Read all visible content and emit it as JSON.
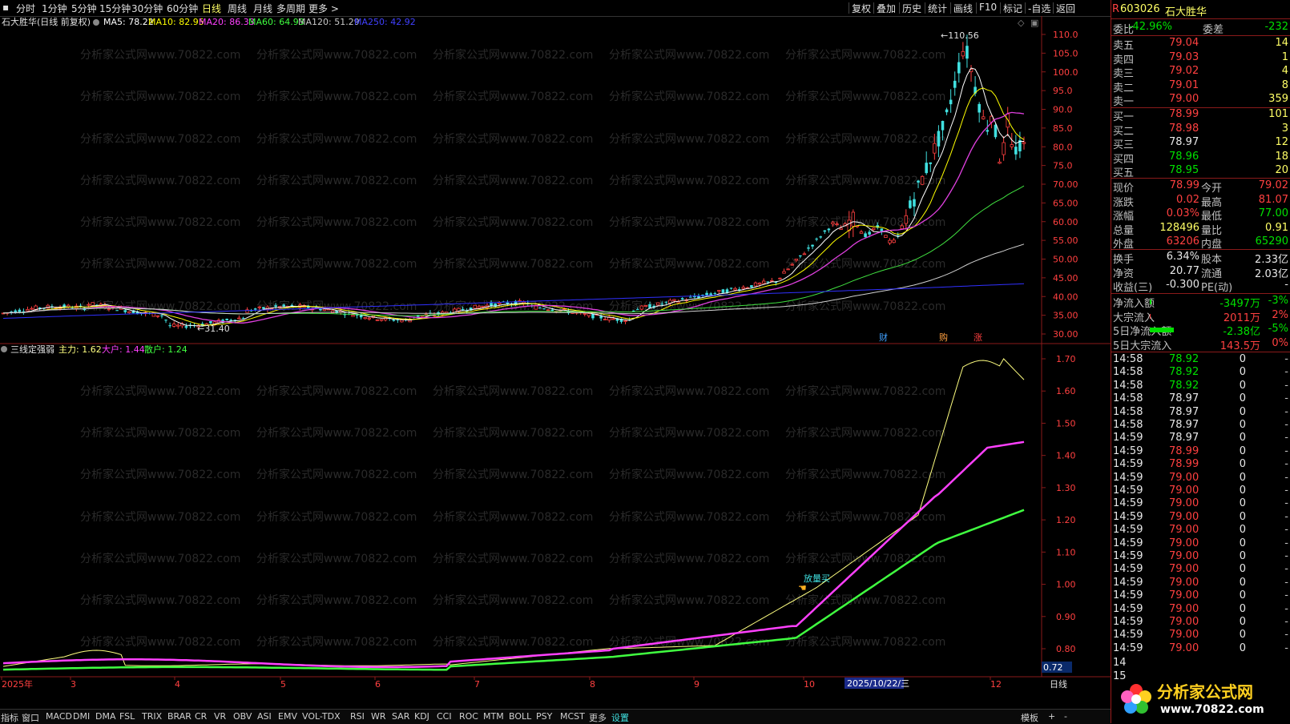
{
  "toolbar": {
    "periods": [
      "分时",
      "1分钟",
      "5分钟",
      "15分钟",
      "30分钟",
      "60分钟",
      "日线",
      "周线",
      "月线",
      "多周期",
      "更多 >"
    ],
    "active_period": "日线",
    "right_tools": [
      "复权",
      "叠加",
      "历史",
      "统计",
      "画线",
      "F10",
      "标记",
      "-自选",
      "返回"
    ]
  },
  "main_chart": {
    "title": "石大胜华(日线 前复权)",
    "ma_labels": [
      {
        "text": "MA5: 78.22",
        "color": "#ffffff"
      },
      {
        "text": "MA10: 82.95",
        "color": "#ffff00"
      },
      {
        "text": "MA20: 86.33",
        "color": "#ff40ff"
      },
      {
        "text": "MA60: 64.93",
        "color": "#40ff40"
      },
      {
        "text": "MA120: 51.29",
        "color": "#c8c8c8"
      },
      {
        "text": "MA250: 42.92",
        "color": "#4040ff"
      }
    ],
    "high_label": "110.56",
    "low_label": "31.40",
    "y_axis": [
      "110.0",
      "105.0",
      "100.0",
      "95.0",
      "90.0",
      "85.0",
      "80.0",
      "75.0",
      "70.00",
      "65.00",
      "60.00",
      "55.00",
      "50.00",
      "45.00",
      "40.00",
      "35.00",
      "30.00"
    ],
    "markers": [
      "财",
      "购",
      "涨"
    ],
    "colors": {
      "up": "#ff4040",
      "down": "#40e0e0",
      "ma5": "#ffffff",
      "ma10": "#ffff00",
      "ma20": "#e040e0",
      "ma60": "#40e040",
      "ma120": "#d0d0d0",
      "ma250": "#3030ff"
    }
  },
  "indicator": {
    "title": "三线定强弱",
    "main_label": "主力: 1.62",
    "large_label": "大户: 1.44",
    "retail_label": "散户: 1.24",
    "y_axis": [
      "1.70",
      "1.60",
      "1.50",
      "1.40",
      "1.30",
      "1.20",
      "1.10",
      "1.00",
      "0.90",
      "0.80"
    ],
    "current_value": "0.72",
    "signal_label": "放量买",
    "colors": {
      "main": "#ffff80",
      "large": "#ff40ff",
      "retail": "#40ff40"
    }
  },
  "time_axis": {
    "labels": [
      "2025年",
      "3",
      "4",
      "5",
      "6",
      "7",
      "8",
      "9",
      "10",
      "12"
    ],
    "cursor_date": "2025/10/22/三",
    "period": "日线"
  },
  "watermark": "分析家公式网www.70822.com",
  "quote": {
    "code": "603026",
    "name": "石大胜华",
    "ratio_label": "委比",
    "ratio": "-42.96%",
    "diff_label": "委差",
    "diff": "-232",
    "asks": [
      {
        "label": "卖五",
        "price": "79.04",
        "vol": "14"
      },
      {
        "label": "卖四",
        "price": "79.03",
        "vol": "1"
      },
      {
        "label": "卖三",
        "price": "79.02",
        "vol": "4"
      },
      {
        "label": "卖二",
        "price": "79.01",
        "vol": "8"
      },
      {
        "label": "卖一",
        "price": "79.00",
        "vol": "359"
      }
    ],
    "bids": [
      {
        "label": "买一",
        "price": "78.99",
        "vol": "101"
      },
      {
        "label": "买二",
        "price": "78.98",
        "vol": "3"
      },
      {
        "label": "买三",
        "price": "78.97",
        "vol": "12"
      },
      {
        "label": "买四",
        "price": "78.96",
        "vol": "18"
      },
      {
        "label": "买五",
        "price": "78.95",
        "vol": "20"
      }
    ],
    "stats": [
      {
        "l1": "现价",
        "v1": "78.99",
        "l2": "今开",
        "v2": "79.02"
      },
      {
        "l1": "涨跌",
        "v1": "0.02",
        "l2": "最高",
        "v2": "81.07"
      },
      {
        "l1": "涨幅",
        "v1": "0.03%",
        "l2": "最低",
        "v2": "77.00"
      },
      {
        "l1": "总量",
        "v1": "128496",
        "l2": "量比",
        "v2": "0.91"
      },
      {
        "l1": "外盘",
        "v1": "63206",
        "l2": "内盘",
        "v2": "65290"
      }
    ],
    "stats2": [
      {
        "l1": "换手",
        "v1": "6.34%",
        "l2": "股本",
        "v2": "2.33亿"
      },
      {
        "l1": "净资",
        "v1": "20.77",
        "l2": "流通",
        "v2": "2.03亿"
      },
      {
        "l1": "收益(三)",
        "v1": "-0.300",
        "l2": "PE(动)",
        "v2": "-"
      }
    ],
    "flows": [
      {
        "label": "净流入额",
        "value": "-3497万",
        "pct": "-3%"
      },
      {
        "label": "大宗流入",
        "value": "2011万",
        "pct": "2%"
      },
      {
        "label": "5日净流入额",
        "value": "-2.38亿",
        "pct": "-5%"
      },
      {
        "label": "5日大宗流入",
        "value": "143.5万",
        "pct": "0%"
      }
    ],
    "ticks": [
      {
        "t": "14:58",
        "p": "78.92",
        "v": "0"
      },
      {
        "t": "14:58",
        "p": "78.92",
        "v": "0"
      },
      {
        "t": "14:58",
        "p": "78.92",
        "v": "0"
      },
      {
        "t": "14:58",
        "p": "78.97",
        "v": "0"
      },
      {
        "t": "14:58",
        "p": "78.97",
        "v": "0"
      },
      {
        "t": "14:58",
        "p": "78.97",
        "v": "0"
      },
      {
        "t": "14:59",
        "p": "78.97",
        "v": "0"
      },
      {
        "t": "14:59",
        "p": "78.99",
        "v": "0"
      },
      {
        "t": "14:59",
        "p": "78.99",
        "v": "0"
      },
      {
        "t": "14:59",
        "p": "79.00",
        "v": "0"
      },
      {
        "t": "14:59",
        "p": "79.00",
        "v": "0"
      },
      {
        "t": "14:59",
        "p": "79.00",
        "v": "0"
      },
      {
        "t": "14:59",
        "p": "79.00",
        "v": "0"
      },
      {
        "t": "14:59",
        "p": "79.00",
        "v": "0"
      },
      {
        "t": "14:59",
        "p": "79.00",
        "v": "0"
      },
      {
        "t": "14:59",
        "p": "79.00",
        "v": "0"
      },
      {
        "t": "14:59",
        "p": "79.00",
        "v": "0"
      },
      {
        "t": "14:59",
        "p": "79.00",
        "v": "0"
      },
      {
        "t": "14:59",
        "p": "79.00",
        "v": "0"
      },
      {
        "t": "14:59",
        "p": "79.00",
        "v": "0"
      },
      {
        "t": "14:59",
        "p": "79.00",
        "v": "0"
      },
      {
        "t": "14:59",
        "p": "79.00",
        "v": "0"
      },
      {
        "t": "14:59",
        "p": "79.00",
        "v": "0"
      }
    ],
    "tick_markers": [
      "14",
      "15"
    ]
  },
  "bottom_tabs": [
    "指标",
    "窗口",
    "MACD",
    "DMI",
    "DMA",
    "FSL",
    "TRIX",
    "BRAR",
    "CR",
    "VR",
    "OBV",
    "ASI",
    "EMV",
    "VOL-TDX",
    "RSI",
    "WR",
    "SAR",
    "KDJ",
    "CCI",
    "ROC",
    "MTM",
    "BOLL",
    "PSY",
    "MCST",
    "更多",
    "设置"
  ],
  "bottom_right": [
    "模板",
    "+",
    "-"
  ],
  "logo": {
    "name": "分析家公式网",
    "url": "www.70822.com"
  }
}
